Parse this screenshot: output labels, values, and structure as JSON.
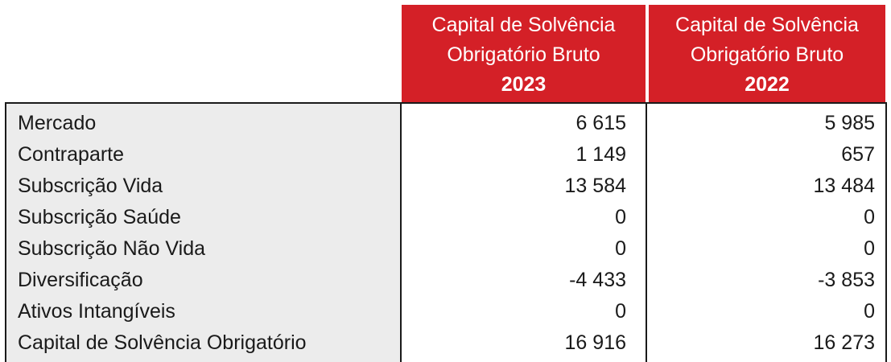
{
  "header": {
    "col1": {
      "line1": "Capital de Solvência",
      "line2": "Obrigatório Bruto",
      "year": "2023"
    },
    "col2": {
      "line1": "Capital de Solvência",
      "line2": "Obrigatório Bruto",
      "year": "2022"
    }
  },
  "rows": [
    {
      "label": "Mercado",
      "v2023": "6 615",
      "v2022": "5 985"
    },
    {
      "label": "Contraparte",
      "v2023": "1 149",
      "v2022": "657"
    },
    {
      "label": "Subscrição Vida",
      "v2023": "13 584",
      "v2022": "13 484"
    },
    {
      "label": "Subscrição Saúde",
      "v2023": "0",
      "v2022": "0"
    },
    {
      "label": "Subscrição Não Vida",
      "v2023": "0",
      "v2022": "0"
    },
    {
      "label": "Diversificação",
      "v2023": "-4 433",
      "v2022": "-3 853"
    },
    {
      "label": "Ativos Intangíveis",
      "v2023": "0",
      "v2022": "0"
    },
    {
      "label": "Capital de Solvência Obrigatório",
      "v2023": "16 916",
      "v2022": "16 273"
    }
  ],
  "colors": {
    "header_bg": "#d42027",
    "label_bg": "#ececec"
  }
}
